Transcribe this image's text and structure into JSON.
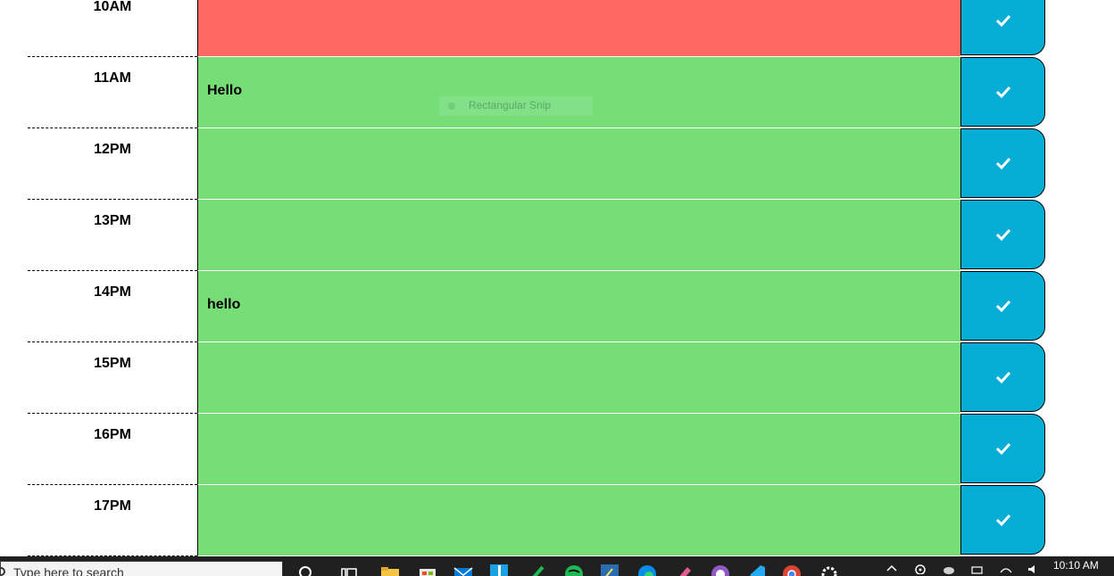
{
  "scheduler": {
    "rows": [
      {
        "hour": "10AM",
        "text": "",
        "state": "past"
      },
      {
        "hour": "11AM",
        "text": "Hello",
        "state": "future"
      },
      {
        "hour": "12PM",
        "text": "",
        "state": "future"
      },
      {
        "hour": "13PM",
        "text": "",
        "state": "future"
      },
      {
        "hour": "14PM",
        "text": "hello",
        "state": "future"
      },
      {
        "hour": "15PM",
        "text": "",
        "state": "future"
      },
      {
        "hour": "16PM",
        "text": "",
        "state": "future"
      },
      {
        "hour": "17PM",
        "text": "",
        "state": "future"
      }
    ],
    "colors": {
      "past": "#ff6961",
      "future": "#77dd77",
      "save": "#06aed5"
    },
    "save_icon": "check-icon"
  },
  "overlay": {
    "label": "Rectangular Snip"
  },
  "taskbar": {
    "search_placeholder": "Type here to search",
    "pinned_icons": [
      "search-icon",
      "task-view-icon",
      "file-explorer-icon",
      "store-icon",
      "mail-icon",
      "app-icon",
      "pen-icon",
      "spotify-icon",
      "editor-icon",
      "edge-icon",
      "paint-icon",
      "github-icon",
      "vscode-icon",
      "chrome-icon",
      "settings-icon"
    ],
    "tray_icons": [
      "chevron-up-icon",
      "location-icon",
      "cloud-icon",
      "battery-icon",
      "wifi-icon",
      "volume-icon"
    ],
    "clock": "10:10 AM"
  }
}
